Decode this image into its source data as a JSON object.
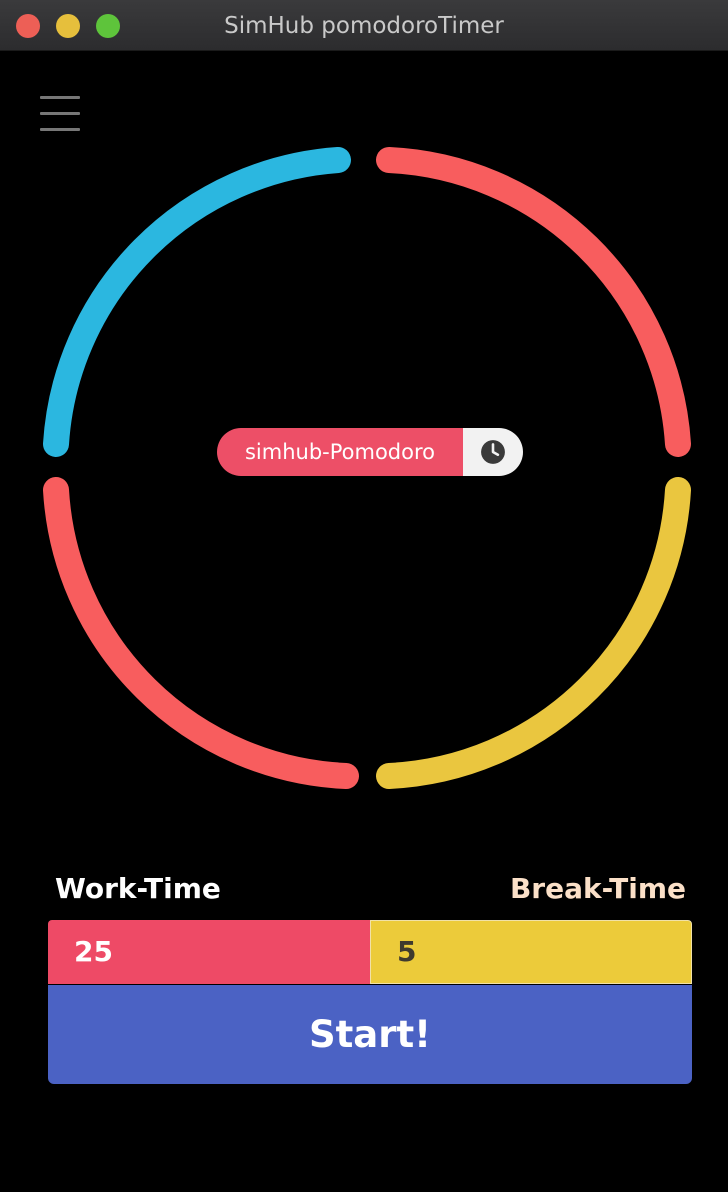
{
  "window": {
    "title": "SimHub pomodoroTimer"
  },
  "menu": {
    "icon": "hamburger-menu-icon"
  },
  "ring": {
    "colors": {
      "top_left": "#2bb7e0",
      "top_right": "#f85d5e",
      "bottom_right": "#eac63f",
      "bottom_left": "#f85d5e"
    }
  },
  "pill": {
    "label": "simhub-Pomodoro",
    "icon": "clock-icon"
  },
  "work": {
    "label": "Work-Time",
    "value": "25"
  },
  "break": {
    "label": "Break-Time",
    "value": "5"
  },
  "start": {
    "label": "Start!"
  },
  "colors": {
    "work_accent": "#ee4a66",
    "break_accent": "#eccb3a",
    "start_button": "#4b62c4",
    "break_label": "#fbe0c8"
  }
}
